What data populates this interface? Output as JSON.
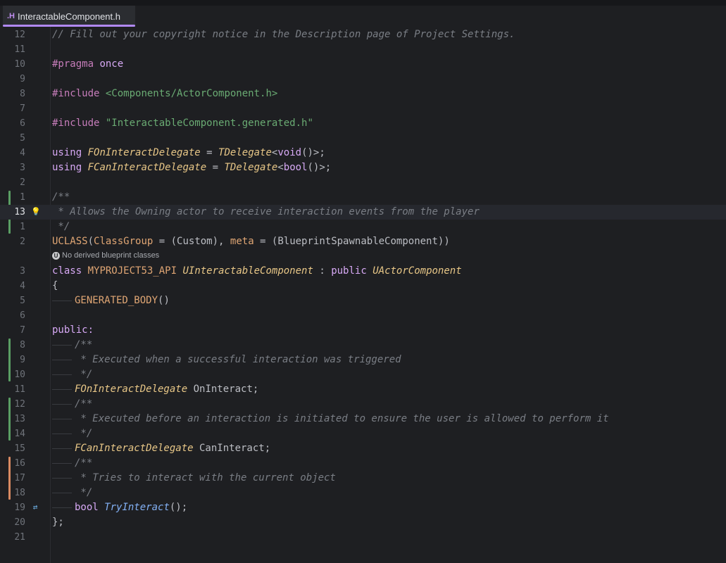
{
  "tab": {
    "icon": ".H",
    "title": "InteractableComponent.h"
  },
  "hint": {
    "icon": "unreal-engine-icon",
    "text": "No derived blueprint classes"
  },
  "lines": [
    {
      "num": "12",
      "text": "// Fill out your copyright notice in the Description page of Project Settings."
    },
    {
      "num": "11",
      "text": ""
    },
    {
      "num": "10",
      "text": "#pragma once"
    },
    {
      "num": "9",
      "text": ""
    },
    {
      "num": "8",
      "text": "#include <Components/ActorComponent.h>"
    },
    {
      "num": "7",
      "text": ""
    },
    {
      "num": "6",
      "text": "#include \"InteractableComponent.generated.h\""
    },
    {
      "num": "5",
      "text": ""
    },
    {
      "num": "4",
      "text": "using FOnInteractDelegate = TDelegate<void()>;"
    },
    {
      "num": "3",
      "text": "using FCanInteractDelegate = TDelegate<bool()>;"
    },
    {
      "num": "2",
      "text": ""
    },
    {
      "num": "1",
      "text": "/**"
    },
    {
      "num": "13",
      "text": " * Allows the Owning actor to receive interaction events from the player"
    },
    {
      "num": "1",
      "text": " */"
    },
    {
      "num": "2",
      "text": "UCLASS(ClassGroup = (Custom), meta = (BlueprintSpawnableComponent))"
    },
    {
      "num": "3",
      "text": "class MYPROJECT53_API UInteractableComponent : public UActorComponent"
    },
    {
      "num": "4",
      "text": "{"
    },
    {
      "num": "5",
      "text": "GENERATED_BODY()"
    },
    {
      "num": "6",
      "text": ""
    },
    {
      "num": "7",
      "text": "public:"
    },
    {
      "num": "8",
      "text": "/**"
    },
    {
      "num": "9",
      "text": " * Executed when a successful interaction was triggered"
    },
    {
      "num": "10",
      "text": " */"
    },
    {
      "num": "11",
      "text": "FOnInteractDelegate OnInteract;"
    },
    {
      "num": "12",
      "text": "/**"
    },
    {
      "num": "13",
      "text": " * Executed before an interaction is initiated to ensure the user is allowed to perform it"
    },
    {
      "num": "14",
      "text": " */"
    },
    {
      "num": "15",
      "text": "FCanInteractDelegate CanInteract;"
    },
    {
      "num": "16",
      "text": "/**"
    },
    {
      "num": "17",
      "text": " * Tries to interact with the current object"
    },
    {
      "num": "18",
      "text": " */"
    },
    {
      "num": "19",
      "text": "bool TryInteract();"
    },
    {
      "num": "20",
      "text": "};"
    },
    {
      "num": "21",
      "text": ""
    }
  ],
  "gutter_icons": {
    "intention": "lightbulb-icon",
    "override": "implementation-arrows-icon"
  },
  "colors": {
    "accent": "#b189f5",
    "added": "#5a9e63",
    "modified": "#d98a62"
  }
}
